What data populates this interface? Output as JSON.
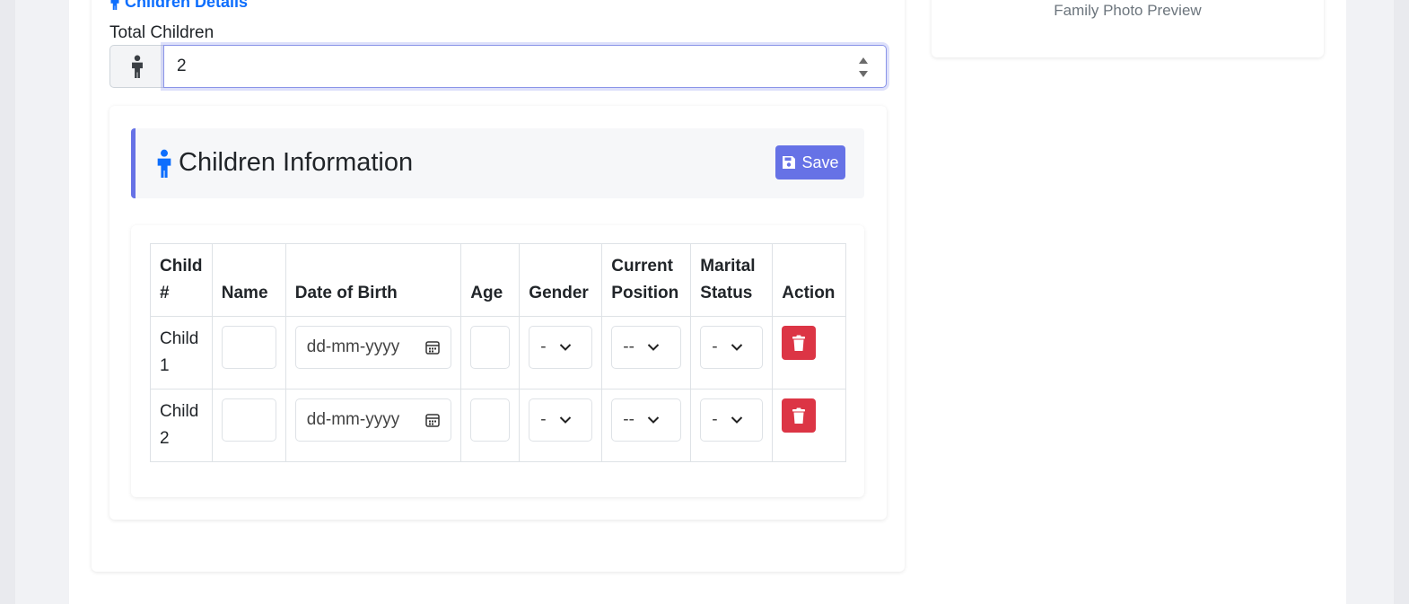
{
  "section": {
    "title": "Children Details"
  },
  "total_children": {
    "label": "Total Children",
    "value": "2"
  },
  "photo_preview": {
    "caption": "Family Photo Preview"
  },
  "children_info": {
    "title": "Children Information",
    "save_label": "Save"
  },
  "table": {
    "headers": {
      "child_line1": "Child",
      "child_line2": "#",
      "name": "Name",
      "dob": "Date of Birth",
      "age": "Age",
      "gender": "Gender",
      "position_line1": "Current",
      "position_line2": "Position",
      "marital_line1": "Marital",
      "marital_line2": "Status",
      "action": "Action"
    },
    "rows": [
      {
        "child_line1": "Child",
        "child_line2": "1",
        "dob_placeholder": "dd-mm-yyyy",
        "gender": "-",
        "position": "--",
        "marital": "-"
      },
      {
        "child_line1": "Child",
        "child_line2": "2",
        "dob_placeholder": "dd-mm-yyyy",
        "gender": "-",
        "position": "--",
        "marital": "-"
      }
    ]
  },
  "colors": {
    "accent": "#6672e6",
    "link": "#0d6efd",
    "danger": "#dc3545"
  },
  "icons": [
    "child-icon",
    "save-icon",
    "calendar-icon",
    "chevron-down-icon",
    "trash-icon"
  ]
}
